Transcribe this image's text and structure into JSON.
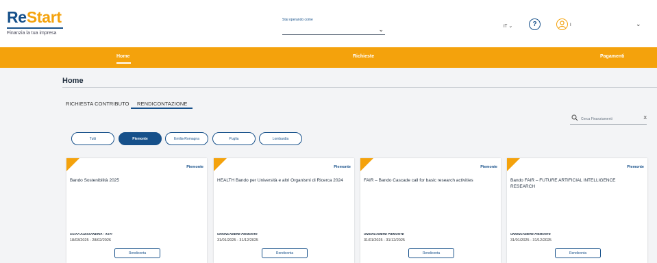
{
  "brand": {
    "logo_re": "Re",
    "logo_start": "Start",
    "tagline": "Finanzia la tua impresa"
  },
  "operating_as": {
    "label": "Stai operando come",
    "value": ""
  },
  "header": {
    "language": "IT",
    "help_symbol": "?",
    "user_name": "I"
  },
  "nav": {
    "items": [
      "Home",
      "Richieste",
      "Pagamenti"
    ],
    "active": "Home"
  },
  "page": {
    "title": "Home"
  },
  "tabs": [
    "RICHIESTA CONTRIBUTO",
    "RENDICONTAZIONE"
  ],
  "search": {
    "placeholder": "Cerca Finanziamenti",
    "clear": "X"
  },
  "filters": [
    "Tutti",
    "Piemonte",
    "Emilia-Romagna",
    "Puglia",
    "Lombardia"
  ],
  "active_filter": "Piemonte",
  "cards": [
    {
      "region": "Piemonte",
      "title": "Bando Sostenibilità 2025",
      "entity": "CCIAA ALESSANDRIA - ASTI",
      "dates": "18/03/2025 - 28/02/2026",
      "button": "Rendiconta"
    },
    {
      "region": "Piemonte",
      "title": "HEALTH Bando per Università e altri Organismi di Ricerca 2024",
      "entity": "UNIONCAMERE PIEMONTE",
      "dates": "31/01/2025 - 31/12/2025",
      "button": "Rendiconta"
    },
    {
      "region": "Piemonte",
      "title": "FAIR – Bando Cascade call for basic research activities",
      "entity": "UNIONCAMERE PIEMONTE",
      "dates": "31/01/2025 - 31/12/2025",
      "button": "Rendiconta"
    },
    {
      "region": "Piemonte",
      "title": "Bando FAIR – FUTURE ARTIFICIAL INTELLIGENCE RESEARCH",
      "entity": "UNIONCAMERE PIEMONTE",
      "dates": "31/01/2025 - 31/12/2025",
      "button": "Rendiconta"
    }
  ],
  "colors": {
    "primary": "#16508a",
    "accent": "#f4a20c",
    "background": "#f3f4f6"
  }
}
